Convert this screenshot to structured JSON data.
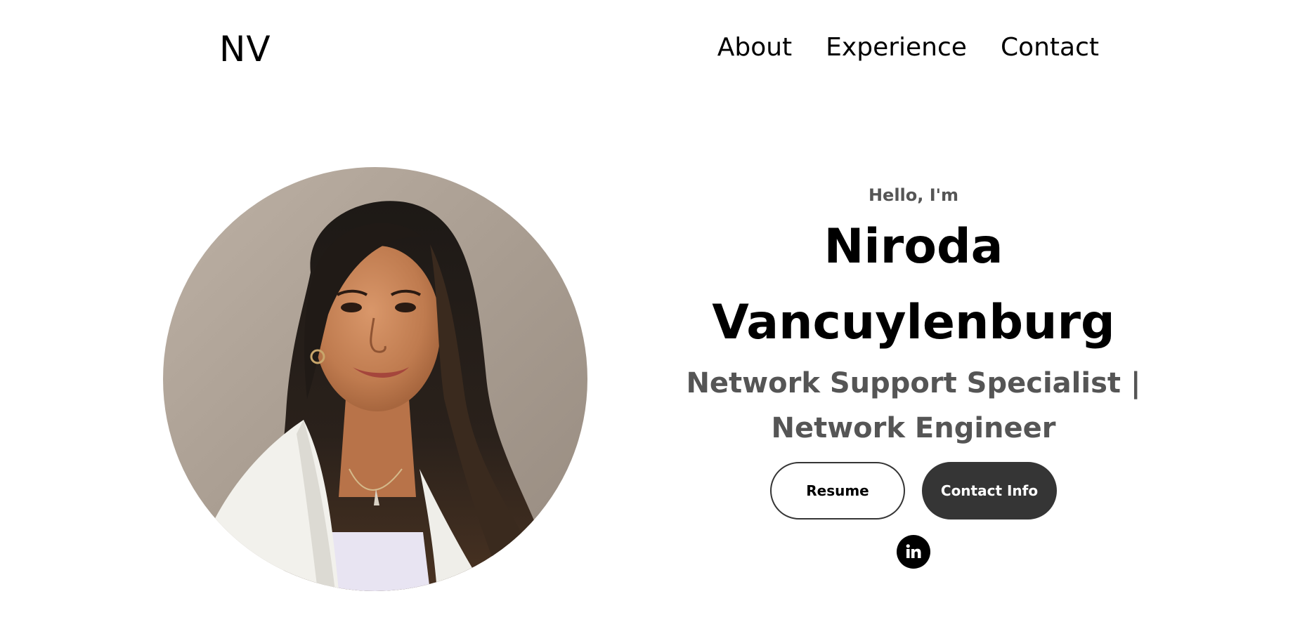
{
  "header": {
    "logo": "NV",
    "nav": [
      {
        "label": "About"
      },
      {
        "label": "Experience"
      },
      {
        "label": "Contact"
      }
    ]
  },
  "hero": {
    "greeting": "Hello, I'm",
    "name_line1": "Niroda",
    "name_line2": "Vancuylenburg",
    "role_line1": "Network Support Specialist |",
    "role_line2": "Network Engineer",
    "buttons": {
      "resume": "Resume",
      "contact_info": "Contact Info"
    },
    "social": {
      "linkedin_icon": "linkedin-icon"
    }
  },
  "colors": {
    "primary_text": "#000000",
    "secondary_text": "#555555",
    "button_dark": "#353535",
    "background": "#ffffff"
  }
}
